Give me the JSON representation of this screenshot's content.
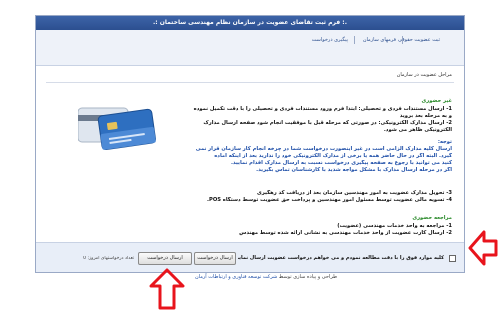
{
  "window": {
    "title": ".: فرم ثبت تقاضای عضویت در سازمان نظام مهندسی ساختمان :."
  },
  "tabs": [
    {
      "label": "ثبت عضویت حقوقی"
    },
    {
      "label": "فرمهای سازمان"
    },
    {
      "label": "پیگیری درخواست"
    }
  ],
  "main": {
    "heading": "مراحل عضویت در سازمان",
    "section1_title": "غیر حضوری",
    "section1_lines": [
      "1- ارسال مستندات فردی و تحصیلی: ابتدا فرم ورود مستندات فردی و تحصیلی را با دقت تکمیل نموده",
      "و به مرحله بعد بروید",
      "2- ارسال مدارک الکترونیکی: در صورتی که مرحله قبل با موفقیت انجام شود صفحه ارسال مدارک",
      "الکترونیکی ظاهر می شود."
    ],
    "note_title": "توجه:",
    "note_lines": [
      "ارسال کلیه مدارک الزامی است در غیر اینصورت درخواست شما در چرخه انجام کار سازمان قرار نمی",
      "گیرد. البته اگر در حال حاضر همه یا برخی از مدارک الکترونیکی خود را ندارید بعد از اینکه آماده",
      "کنید می توانید با رجوع به صفحه پیگیری درخواست نسبت به ارسال مدارک اقدام نمایید.",
      "اگر در مرحله ارسال مدارک با مشکل مواجه شدید با کارشناسان تماس بگیرید."
    ],
    "section2_lines": [
      "3- تحویل مدارک عضویت به امور مهندسین سازمان بعد از دریافت کد رهگیری",
      "4- تسویه مالی عضویت توسط مسئول امور مهندسین و پرداخت حق عضویت توسط دستگاه POS."
    ],
    "section3_title": "مراجعه حضوری",
    "section3_lines": [
      "1- مراجعه به واحد خدمات مهندسی (عضویت)",
      "2- ارسال کارت عضویت از واحد خدمات مهندسی به نشانی ارائه شده توسط مهندس"
    ]
  },
  "footer": {
    "agree_text": "کلیه موارد فوق را با دقت مطالعه نمودم و می خواهم درخواست عضویت ارسال نمایم",
    "submit_label": "ارسال درخواست",
    "request_button_label": "ارسال درخواست",
    "count_label": "تعداد درخواستهای امروز: 0"
  },
  "below": {
    "design_label": "طراحی و پیاده سازی توسط",
    "company_link": "شرکت توسعه فناوری و ارتباطات آرمان"
  },
  "colors": {
    "title_bar": "#2c4f90",
    "accent_green": "#2a8a2a",
    "arrow_red": "#e8141c"
  }
}
